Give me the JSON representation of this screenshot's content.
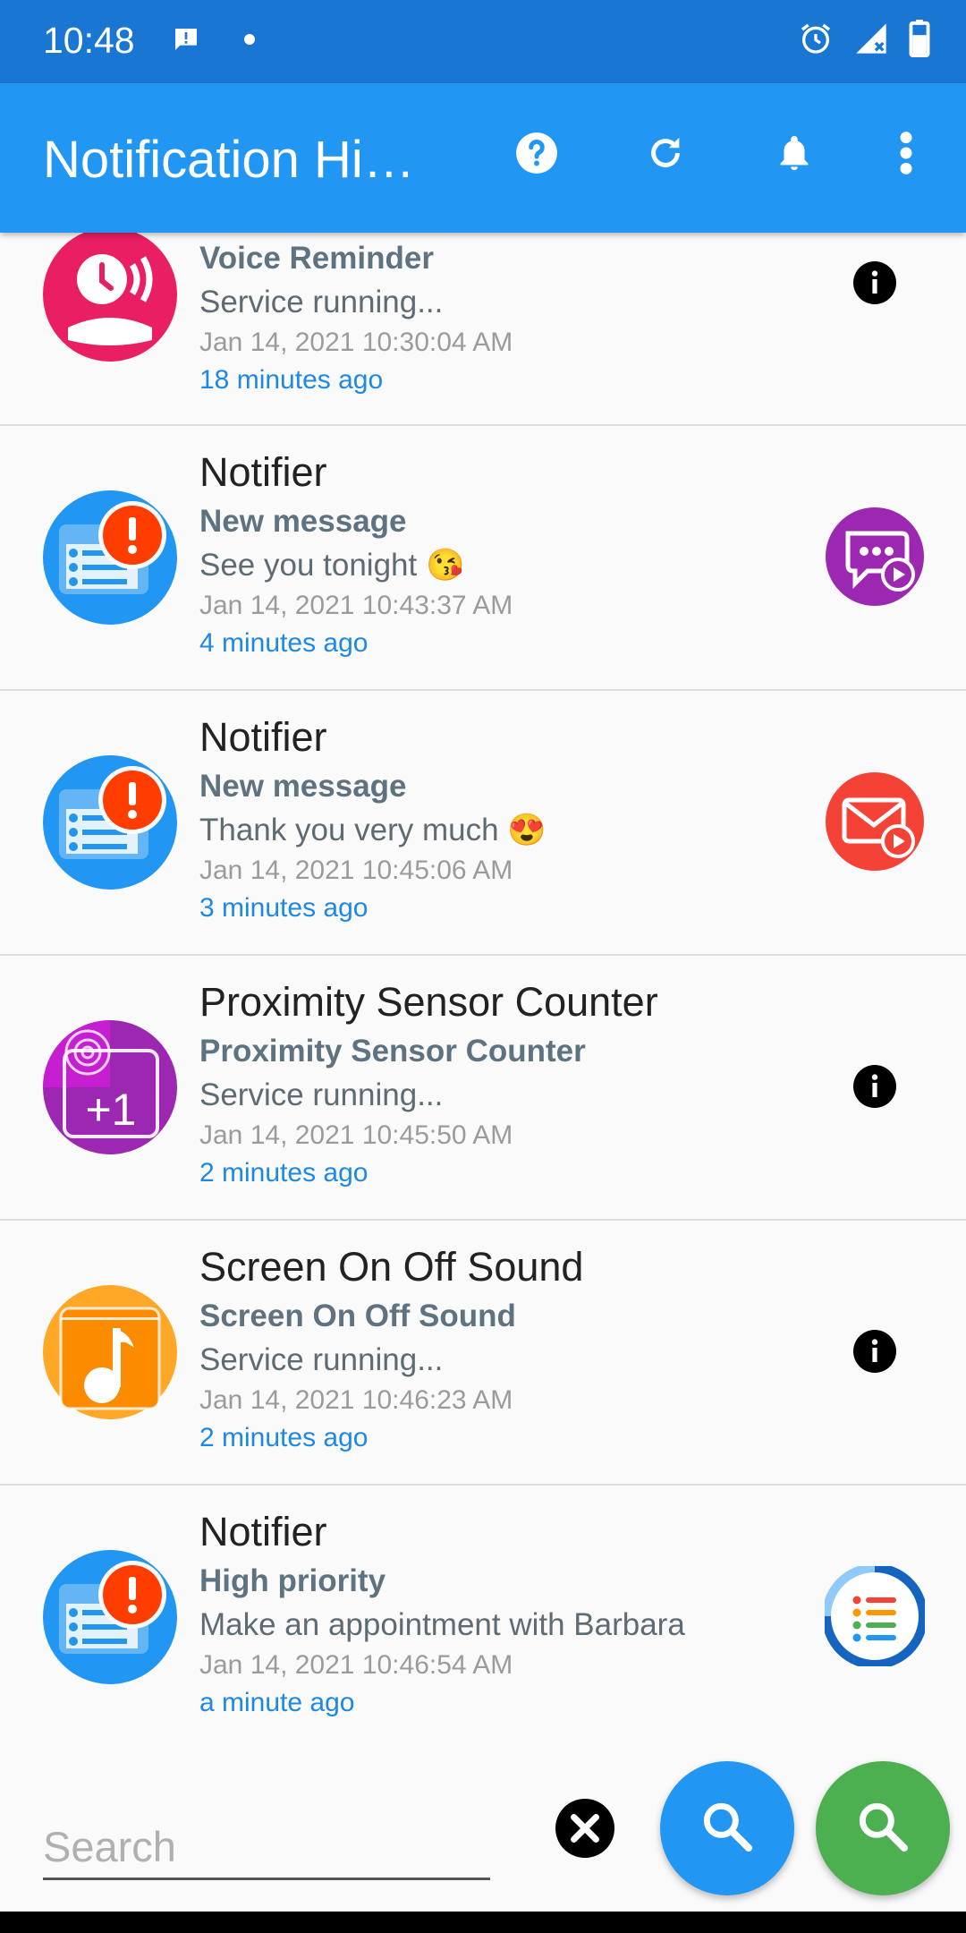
{
  "status_bar": {
    "time": "10:48"
  },
  "app_bar": {
    "title": "Notification History Log"
  },
  "notifications": [
    {
      "app_name": "",
      "title": "Voice Reminder",
      "text": "Service running...",
      "date": "Jan 14, 2021 10:30:04 AM",
      "relative": "18 minutes ago",
      "icon": "voice-reminder-icon",
      "right_icon": "info-icon"
    },
    {
      "app_name": "Notifier",
      "title": "New message",
      "text": "See you tonight 😘",
      "date": "Jan 14, 2021 10:43:37 AM",
      "relative": "4 minutes ago",
      "icon": "notifier-icon",
      "right_icon": "chat-video-icon"
    },
    {
      "app_name": "Notifier",
      "title": "New message",
      "text": "Thank you very much 😍",
      "date": "Jan 14, 2021 10:45:06 AM",
      "relative": "3 minutes ago",
      "icon": "notifier-icon",
      "right_icon": "mail-video-icon"
    },
    {
      "app_name": "Proximity Sensor Counter",
      "title": "Proximity Sensor Counter",
      "text": "Service running...",
      "date": "Jan 14, 2021 10:45:50 AM",
      "relative": "2 minutes ago",
      "icon": "proximity-counter-icon",
      "right_icon": "info-icon"
    },
    {
      "app_name": "Screen On Off Sound",
      "title": "Screen On Off Sound",
      "text": "Service running...",
      "date": "Jan 14, 2021 10:46:23 AM",
      "relative": "2 minutes ago",
      "icon": "music-note-icon",
      "right_icon": "info-icon"
    },
    {
      "app_name": "Notifier",
      "title": "High priority",
      "text": "Make an appointment with Barbara",
      "date": "Jan 14, 2021 10:46:54 AM",
      "relative": "a minute ago",
      "icon": "notifier-icon",
      "right_icon": "task-list-icon"
    }
  ],
  "search": {
    "placeholder": "Search",
    "value": ""
  },
  "colors": {
    "status_bar": "#1976d2",
    "app_bar": "#2196f3",
    "fab_blue": "#2196f3",
    "fab_green": "#4caf50",
    "link": "#1e88e5"
  }
}
